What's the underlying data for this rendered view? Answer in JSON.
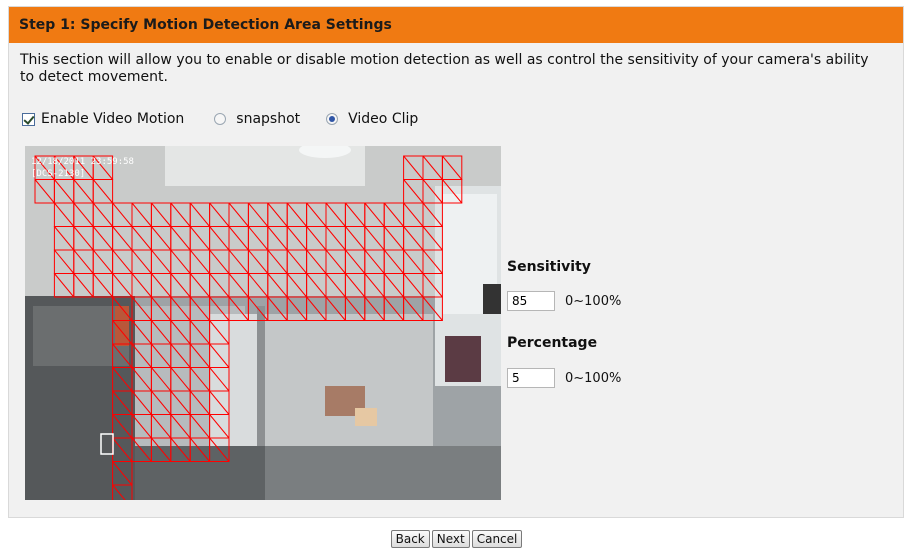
{
  "header": {
    "title": "Step 1: Specify Motion Detection Area Settings"
  },
  "description": "This section will allow you to enable or disable motion detection as well as control the sensitivity of your camera's ability to detect movement.",
  "options": {
    "enable_label": "Enable Video Motion",
    "enable_checked": true,
    "snapshot_label": "snapshot",
    "videoclip_label": "Video Clip",
    "selected": "Video Clip"
  },
  "video": {
    "overlay_line1": "12/18/2011  23:59:58",
    "overlay_line2": "[DCS-2130]",
    "grid_color": "#ff0000"
  },
  "sensitivity": {
    "label": "Sensitivity",
    "value": "85",
    "range": "0~100%"
  },
  "percentage": {
    "label": "Percentage",
    "value": "5",
    "range": "0~100%"
  },
  "buttons": {
    "back": "Back",
    "next": "Next",
    "cancel": "Cancel"
  },
  "colors": {
    "header": "#f07a12",
    "panel": "#f1f1f1"
  }
}
